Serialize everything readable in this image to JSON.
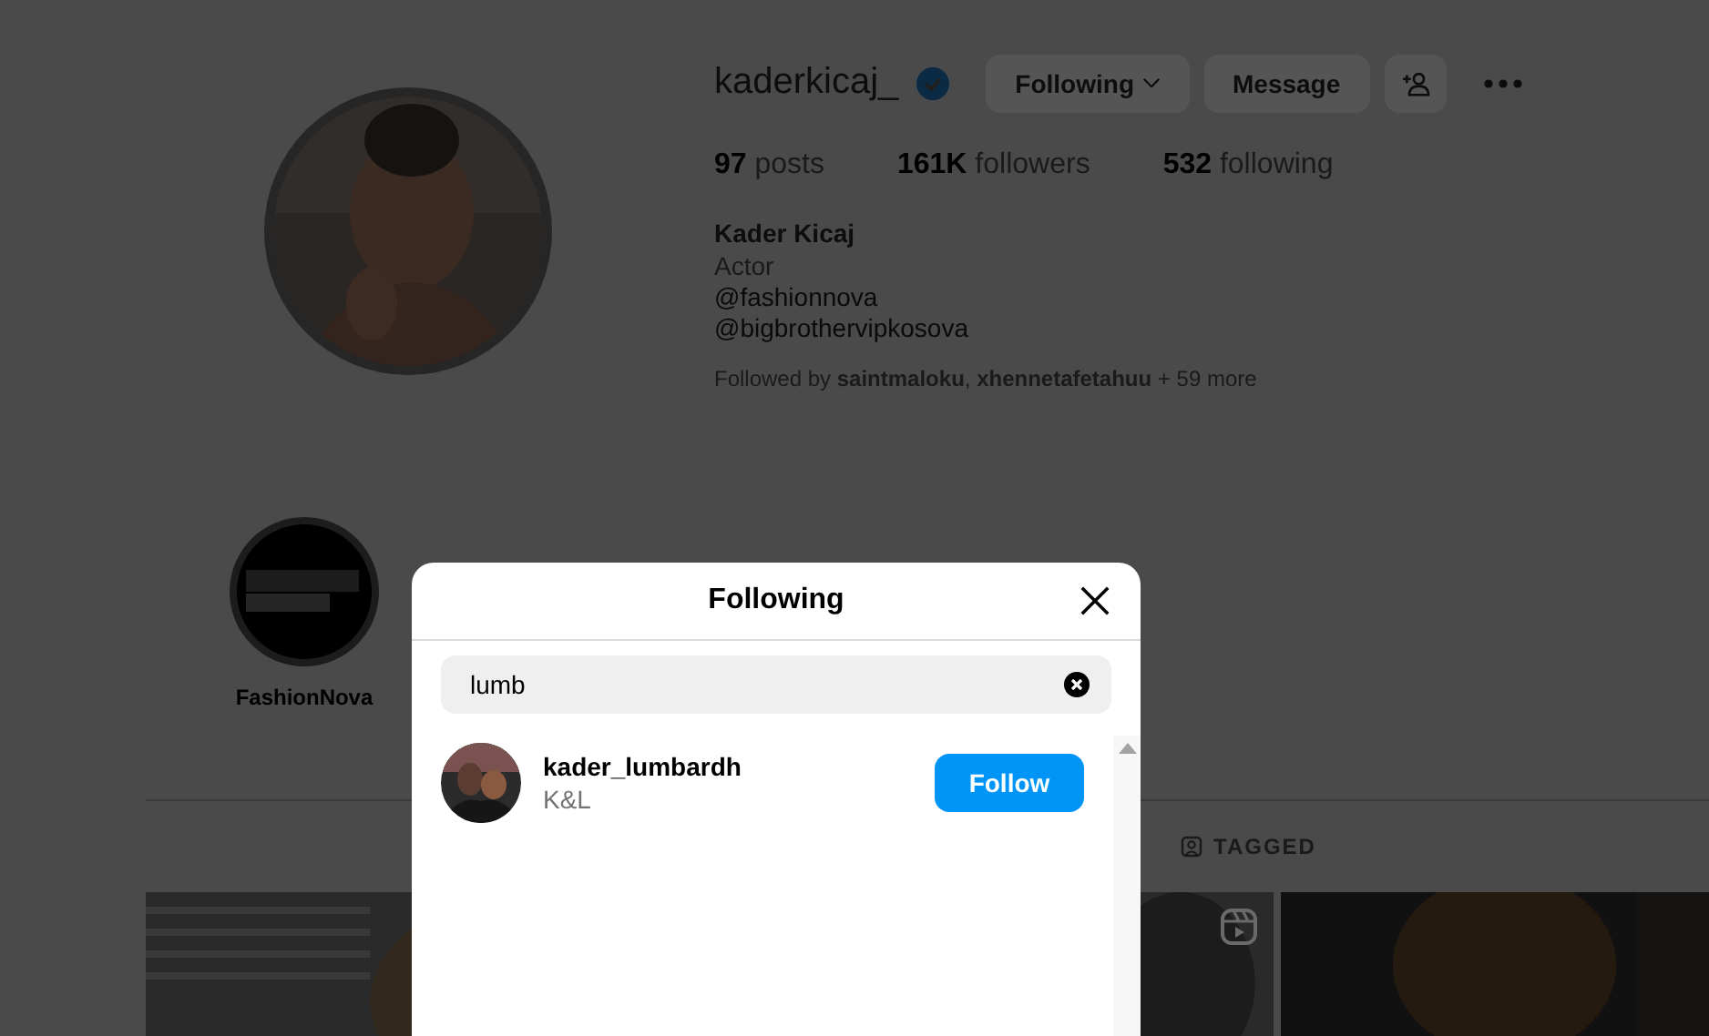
{
  "profile": {
    "username": "kaderkicaj_",
    "verified": true,
    "buttons": [
      {
        "label": "Following",
        "kind": "dropdown"
      },
      {
        "label": "Message",
        "kind": "plain"
      }
    ],
    "stats": [
      {
        "count": "97",
        "label": "posts"
      },
      {
        "count": "161K",
        "label": "followers"
      },
      {
        "count": "532",
        "label": "following"
      }
    ],
    "name": "Kader Kicaj",
    "category": "Actor",
    "links": [
      "@fashionnova",
      "@bigbrothervipkosova"
    ],
    "followed_by": "Followed by **saintmaloku**, **xhennetafetahuu** + 59 more"
  },
  "highlights": [
    {
      "label": "FashionNova"
    }
  ],
  "tabs": [
    {
      "label": "TAGGED",
      "selected": false
    }
  ],
  "posts": [
    {
      "reel": false
    },
    {
      "reel": true
    },
    {
      "reel": false
    }
  ],
  "modal": {
    "title": "Following",
    "search": {
      "value": "lumb"
    },
    "results": [
      {
        "username": "kader_lumbardh",
        "subtitle": "K&L",
        "button": "Follow"
      }
    ]
  }
}
